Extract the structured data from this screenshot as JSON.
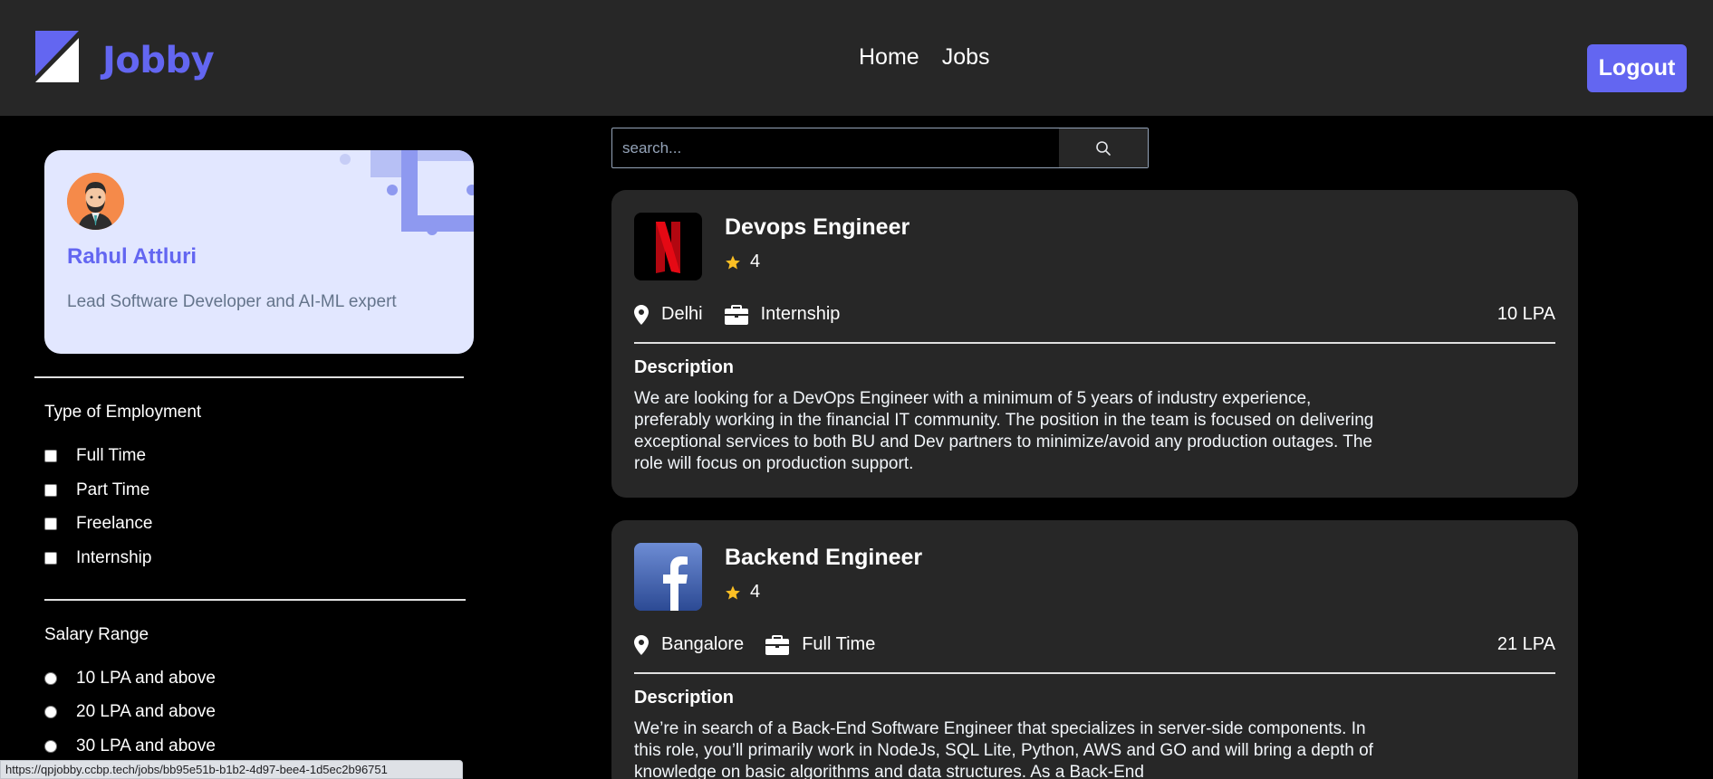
{
  "header": {
    "brand": "Jobby",
    "nav": [
      "Home",
      "Jobs"
    ],
    "logout_label": "Logout",
    "accent": "#6366f1"
  },
  "profile": {
    "name": "Rahul Attluri",
    "bio": "Lead Software Developer and AI-ML expert"
  },
  "filters": {
    "employment_title": "Type of Employment",
    "employment_options": [
      "Full Time",
      "Part Time",
      "Freelance",
      "Internship"
    ],
    "salary_title": "Salary Range",
    "salary_options": [
      "10 LPA and above",
      "20 LPA and above",
      "30 LPA and above"
    ]
  },
  "search": {
    "placeholder": "search..."
  },
  "jobs": [
    {
      "title": "Devops Engineer",
      "rating": "4",
      "location": "Delhi",
      "type": "Internship",
      "package": "10 LPA",
      "description_label": "Description",
      "description": "We are looking for a DevOps Engineer with a minimum of 5 years of industry experience, preferably working in the financial IT community. The position in the team is focused on delivering exceptional services to both BU and Dev partners to minimize/avoid any production outages. The role will focus on production support.",
      "logo_icon": "netflix-logo"
    },
    {
      "title": "Backend Engineer",
      "rating": "4",
      "location": "Bangalore",
      "type": "Full Time",
      "package": "21 LPA",
      "description_label": "Description",
      "description": "We’re in search of a Back-End Software Engineer that specializes in server-side components. In this role, you’ll primarily work in NodeJs, SQL Lite, Python, AWS and GO and will bring a depth of knowledge on basic algorithms and data structures. As a Back-End",
      "logo_icon": "facebook-logo"
    }
  ],
  "status_bar": {
    "url": "https://qpjobby.ccbp.tech/jobs/bb95e51b-b1b2-4d97-bee4-1d5ec2b96751"
  }
}
